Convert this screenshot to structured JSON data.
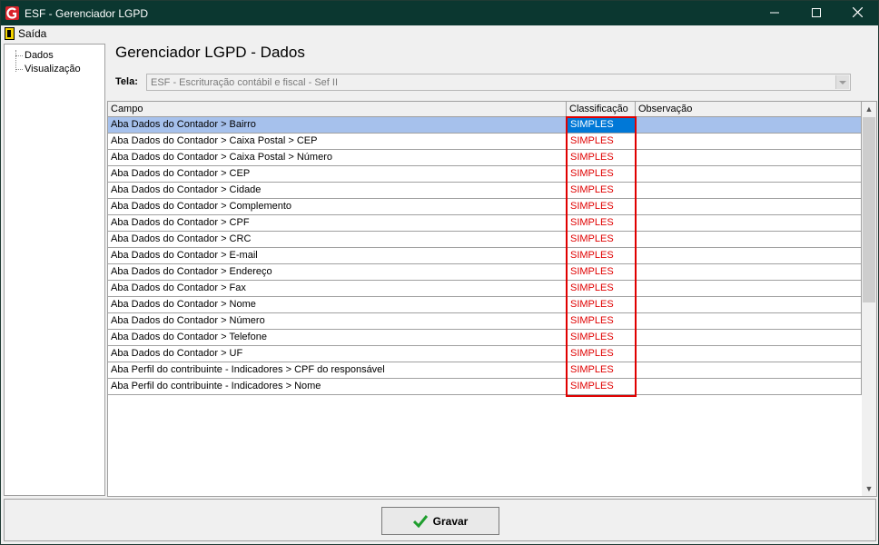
{
  "window": {
    "title": "ESF - Gerenciador LGPD"
  },
  "menu": {
    "exit_label": "Saída"
  },
  "tree": {
    "items": [
      "Dados",
      "Visualização"
    ]
  },
  "page": {
    "title": "Gerenciador LGPD - Dados"
  },
  "tela": {
    "label": "Tela:",
    "value": "ESF - Escrituração contábil e fiscal - Sef II"
  },
  "grid": {
    "columns": [
      "Campo",
      "Classificação",
      "Observação"
    ],
    "rows": [
      {
        "campo": "Aba Dados do Contador > Bairro",
        "classificacao": "SIMPLES",
        "observacao": ""
      },
      {
        "campo": "Aba Dados do Contador > Caixa Postal > CEP",
        "classificacao": "SIMPLES",
        "observacao": ""
      },
      {
        "campo": "Aba Dados do Contador > Caixa Postal > Número",
        "classificacao": "SIMPLES",
        "observacao": ""
      },
      {
        "campo": "Aba Dados do Contador > CEP",
        "classificacao": "SIMPLES",
        "observacao": ""
      },
      {
        "campo": "Aba Dados do Contador > Cidade",
        "classificacao": "SIMPLES",
        "observacao": ""
      },
      {
        "campo": "Aba Dados do Contador > Complemento",
        "classificacao": "SIMPLES",
        "observacao": ""
      },
      {
        "campo": "Aba Dados do Contador > CPF",
        "classificacao": "SIMPLES",
        "observacao": ""
      },
      {
        "campo": "Aba Dados do Contador > CRC",
        "classificacao": "SIMPLES",
        "observacao": ""
      },
      {
        "campo": "Aba Dados do Contador > E-mail",
        "classificacao": "SIMPLES",
        "observacao": ""
      },
      {
        "campo": "Aba Dados do Contador > Endereço",
        "classificacao": "SIMPLES",
        "observacao": ""
      },
      {
        "campo": "Aba Dados do Contador > Fax",
        "classificacao": "SIMPLES",
        "observacao": ""
      },
      {
        "campo": "Aba Dados do Contador > Nome",
        "classificacao": "SIMPLES",
        "observacao": ""
      },
      {
        "campo": "Aba Dados do Contador > Número",
        "classificacao": "SIMPLES",
        "observacao": ""
      },
      {
        "campo": "Aba Dados do Contador > Telefone",
        "classificacao": "SIMPLES",
        "observacao": ""
      },
      {
        "campo": "Aba Dados do Contador > UF",
        "classificacao": "SIMPLES",
        "observacao": ""
      },
      {
        "campo": "Aba Perfil do contribuinte - Indicadores > CPF do responsável",
        "classificacao": "SIMPLES",
        "observacao": ""
      },
      {
        "campo": "Aba Perfil do contribuinte - Indicadores > Nome",
        "classificacao": "SIMPLES",
        "observacao": ""
      }
    ]
  },
  "actions": {
    "save_label": "Gravar"
  },
  "colors": {
    "titlebar": "#0b3730",
    "selected_row": "#a6c1ec",
    "selected_cell": "#0078d7",
    "classification_text": "#e00000",
    "highlight": "#e00000",
    "save_check": "#1f9e2e"
  }
}
